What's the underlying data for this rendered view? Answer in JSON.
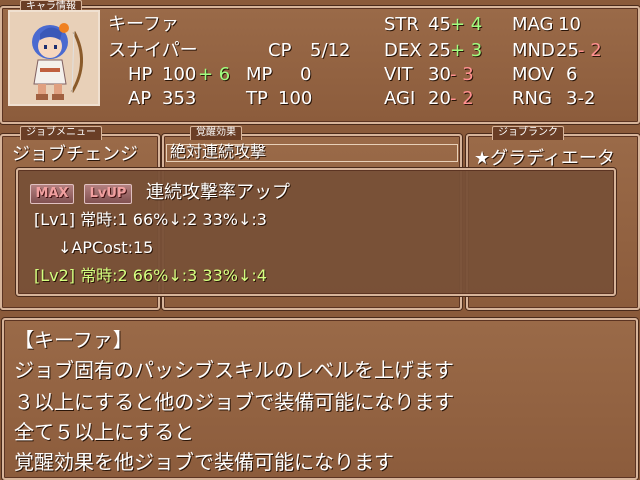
{
  "tabs": {
    "chara_info": "キャラ情報",
    "job_menu": "ジョブメニュー",
    "awaken": "覚醒効果",
    "job_rank": "ジョブランク"
  },
  "character": {
    "name": "キーファ",
    "job": "スナイパー",
    "cp_label": "CP",
    "cp_value": "5/12",
    "hp_label": "HP",
    "hp_value": "100",
    "hp_bonus": "+ 6",
    "mp_label": "MP",
    "mp_value": "0",
    "ap_label": "AP",
    "ap_value": "353",
    "tp_label": "TP",
    "tp_value": "100"
  },
  "stats": [
    {
      "label": "STR",
      "value": "45",
      "mod": "+ 4",
      "mod_color": "green"
    },
    {
      "label": "DEX",
      "value": "25",
      "mod": "+ 3",
      "mod_color": "green"
    },
    {
      "label": "VIT",
      "value": "30",
      "mod": "- 3",
      "mod_color": "pink"
    },
    {
      "label": "AGI",
      "value": "20",
      "mod": "- 2",
      "mod_color": "pink"
    }
  ],
  "stats2": [
    {
      "label": "MAG",
      "value": "10",
      "mod": ""
    },
    {
      "label": "MND",
      "value": "25",
      "mod": "- 2"
    },
    {
      "label": "MOV",
      "value": "6",
      "mod": ""
    },
    {
      "label": "RNG",
      "value": "3-2",
      "mod": ""
    }
  ],
  "job_menu_item": "ジョブチェンジ",
  "awaken_item": "絶対連続攻撃",
  "job_rank_item": "★グラディエータ",
  "popup": {
    "max_label": "MAX",
    "lvup_label": "LvUP",
    "skill_name": "連続攻撃率アップ",
    "lv1_line": "[Lv1] 常時:1 66%↓:2 33%↓:3",
    "lv1_cost": "↓APCost:15",
    "lv2_line": "[Lv2] 常時:2 66%↓:3 33%↓:4"
  },
  "message": {
    "speaker": "【キーファ】",
    "lines": [
      "ジョブ固有のパッシブスキルのレベルを上げます",
      "３以上にすると他のジョブで装備可能になります",
      "全て５以上にすると",
      "覚醒効果を他ジョブで装備可能になります"
    ]
  }
}
